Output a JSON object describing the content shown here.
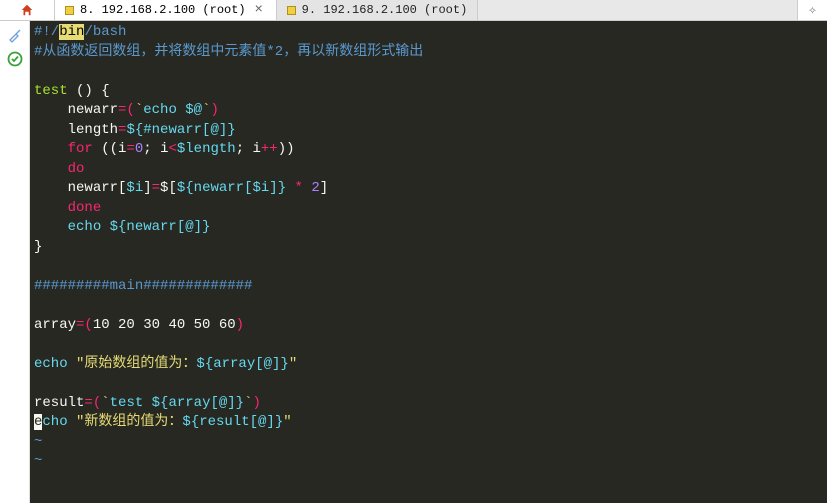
{
  "tabs": {
    "active": {
      "label": "8. 192.168.2.100 (root)"
    },
    "inactive": {
      "label": "9. 192.168.2.100 (root)"
    }
  },
  "code": {
    "l1_shebang_pre": "#!/",
    "l1_bin": "bin",
    "l1_bash": "/bash",
    "l2_comment": "#从函数返回数组，并将数组中元素值*2，再以新数组形式输出",
    "l4_test": "test ",
    "l4_paren": "() ",
    "l4_brace": "{",
    "l5_indent": "    ",
    "l5_newarr": "newarr",
    "l5_eq": "=(",
    "l5_tick1": "`",
    "l5_echo": "echo ",
    "l5_var": "$@",
    "l5_tick2": "`",
    "l5_close": ")",
    "l6_indent": "    ",
    "l6_length": "length",
    "l6_eq": "=",
    "l6_expr": "${#newarr[@]}",
    "l7_indent": "    ",
    "l7_for": "for ",
    "l7_open": "((",
    "l7_i1": "i",
    "l7_eq": "=",
    "l7_zero": "0",
    "l7_semi1": "; ",
    "l7_i2": "i",
    "l7_lt": "<",
    "l7_len": "$length",
    "l7_semi2": "; ",
    "l7_i3": "i",
    "l7_pp": "++",
    "l7_close": "))",
    "l8_indent": "    ",
    "l8_do": "do",
    "l9_indent": "    ",
    "l9_lhs": "newarr[",
    "l9_i": "$i",
    "l9_rb": "]",
    "l9_eq": "=",
    "l9_rhs1": "$[",
    "l9_rhs2": "${newarr[",
    "l9_rhs_i": "$i",
    "l9_rhs3": "]}",
    "l9_sp": " ",
    "l9_mul": "*",
    "l9_sp2": " ",
    "l9_two": "2",
    "l9_rhs4": "]",
    "l10_indent": "    ",
    "l10_done": "done",
    "l11_indent": "    ",
    "l11_echo": "echo ",
    "l11_var": "${newarr[@]}",
    "l12_brace": "}",
    "l14_main": "#########main#############",
    "l16_array": "array",
    "l16_eq": "=(",
    "l16_vals": "10 20 30 40 50 60",
    "l16_close": ")",
    "l18_echo": "echo ",
    "l18_q1": "\"",
    "l18_txt": "原始数组的值为：",
    "l18_var": "${array[@]}",
    "l18_q2": "\"",
    "l20_result": "result",
    "l20_eq": "=(",
    "l20_tick1": "`",
    "l20_test": "test ",
    "l20_var": "${array[@]}",
    "l20_tick2": "`",
    "l20_close": ")",
    "l21_e": "e",
    "l21_cho": "cho ",
    "l21_q1": "\"",
    "l21_txt": "新数组的值为：",
    "l21_var": "${result[@]}",
    "l21_q2": "\"",
    "tilde": "~"
  }
}
